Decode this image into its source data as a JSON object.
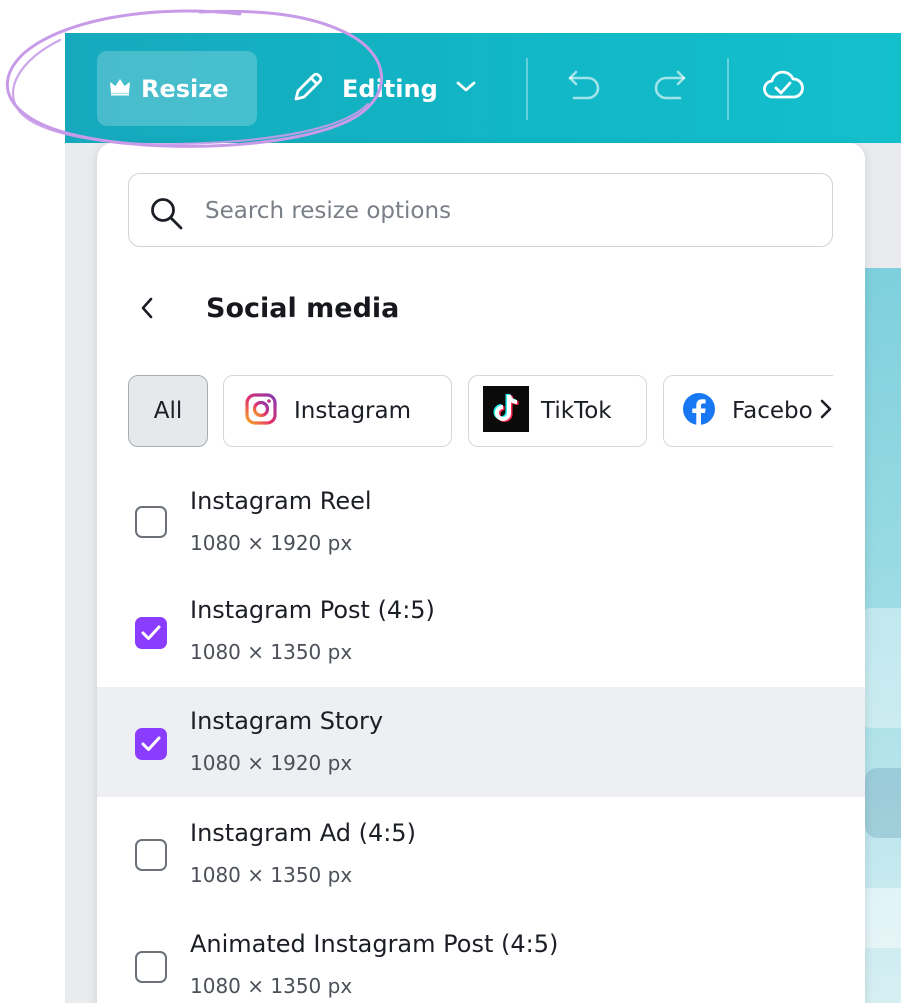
{
  "toolbar": {
    "resize_label": "Resize",
    "editing_label": "Editing",
    "crown_icon": "crown-icon",
    "pencil_icon": "pencil-icon",
    "undo_icon": "undo-icon",
    "redo_icon": "redo-icon",
    "cloud_icon": "cloud-check-icon"
  },
  "search": {
    "placeholder": "Search resize options"
  },
  "section": {
    "title": "Social media"
  },
  "filters": [
    {
      "label": "All",
      "selected": true
    },
    {
      "label": "Instagram",
      "icon": "instagram-icon"
    },
    {
      "label": "TikTok",
      "icon": "tiktok-icon"
    },
    {
      "label": "Facebo",
      "icon": "facebook-icon"
    }
  ],
  "items": [
    {
      "name": "Instagram Reel",
      "dimensions": "1080 × 1920 px",
      "checked": false
    },
    {
      "name": "Instagram Post (4:5)",
      "dimensions": "1080 × 1350 px",
      "checked": true
    },
    {
      "name": "Instagram Story",
      "dimensions": "1080 × 1920 px",
      "checked": true
    },
    {
      "name": "Instagram Ad (4:5)",
      "dimensions": "1080 × 1350 px",
      "checked": false
    },
    {
      "name": "Animated Instagram Post (4:5)",
      "dimensions": "1080 × 1350 px",
      "checked": false
    }
  ],
  "colors": {
    "toolbar": "#11b7c6",
    "checkbox_checked": "#8b3dff",
    "annotation_circle": "#c89be8"
  }
}
